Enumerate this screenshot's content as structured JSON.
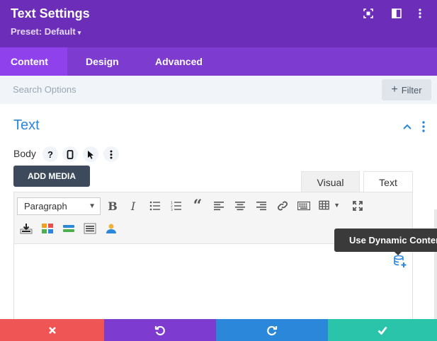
{
  "header": {
    "title": "Text Settings",
    "preset_label": "Preset: Default",
    "background": "#6c2eb9",
    "icons": [
      "focus-expand-icon",
      "split-panel-icon",
      "more-vertical-icon"
    ]
  },
  "tabs": [
    {
      "label": "Content",
      "active": true
    },
    {
      "label": "Design",
      "active": false
    },
    {
      "label": "Advanced",
      "active": false
    }
  ],
  "search": {
    "placeholder": "Search Options",
    "filter_label": "Filter"
  },
  "section": {
    "title": "Text",
    "accent": "#2b87da"
  },
  "body_field": {
    "label": "Body",
    "help_glyph": "?"
  },
  "editor": {
    "add_media_label": "ADD MEDIA",
    "tabs": [
      {
        "label": "Visual",
        "active": false
      },
      {
        "label": "Text",
        "active": true
      }
    ],
    "format_select": {
      "selected": "Paragraph"
    },
    "toolbar_row1": [
      "bold-icon",
      "italic-icon",
      "bulleted-list-icon",
      "numbered-list-icon",
      "blockquote-icon",
      "align-left-icon",
      "align-center-icon",
      "align-right-icon",
      "link-icon",
      "keyboard-icon",
      "table-icon",
      "fullscreen-icon"
    ],
    "toolbar_row2": [
      "import-icon",
      "layout-grid-icon",
      "divider-icon",
      "shortcode-icon",
      "user-icon"
    ],
    "content": ""
  },
  "tooltip": {
    "text": "Use Dynamic Content"
  },
  "footer": {
    "buttons": [
      {
        "name": "discard",
        "color": "#ef5555",
        "icon": "close-icon"
      },
      {
        "name": "undo",
        "color": "#7e3bd0",
        "icon": "undo-icon"
      },
      {
        "name": "redo",
        "color": "#2b87da",
        "icon": "redo-icon"
      },
      {
        "name": "save",
        "color": "#29c4a9",
        "icon": "check-icon"
      }
    ]
  }
}
